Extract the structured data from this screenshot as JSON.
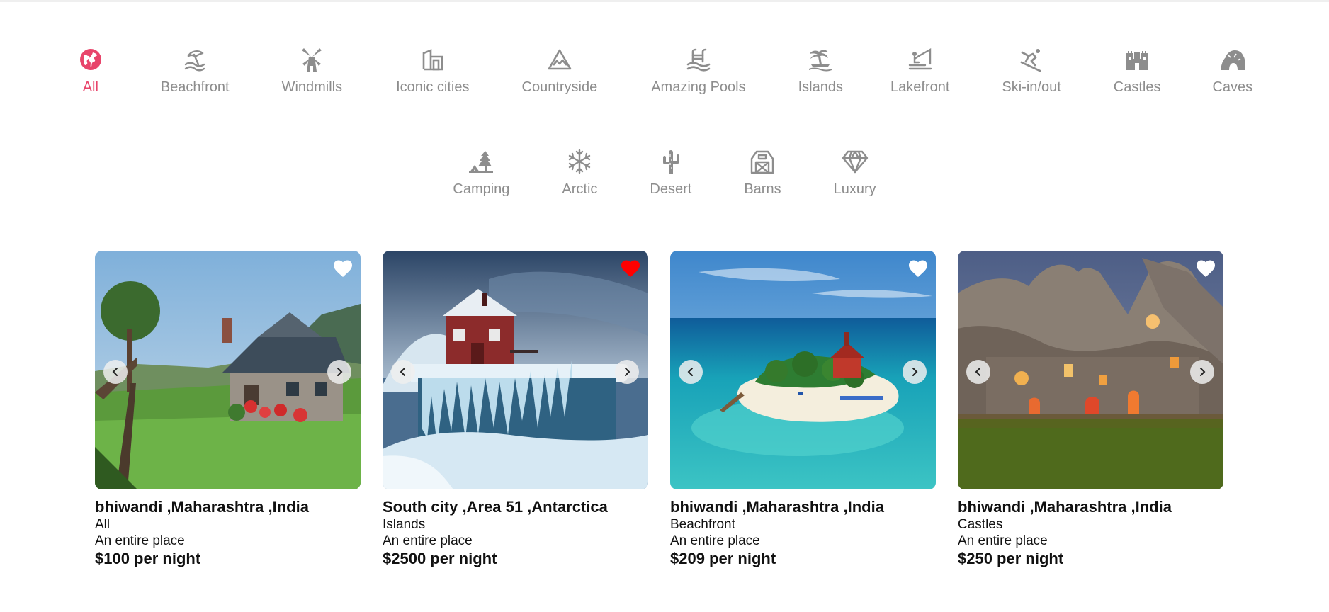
{
  "categories_row1": [
    {
      "label": "All",
      "icon": "globe-icon",
      "active": true
    },
    {
      "label": "Beachfront",
      "icon": "beach-umbrella-icon"
    },
    {
      "label": "Windmills",
      "icon": "windmill-icon"
    },
    {
      "label": "Iconic cities",
      "icon": "city-building-icon"
    },
    {
      "label": "Countryside",
      "icon": "mountain-icon"
    },
    {
      "label": "Amazing Pools",
      "icon": "pool-icon"
    },
    {
      "label": "Islands",
      "icon": "palm-island-icon"
    },
    {
      "label": "Lakefront",
      "icon": "fishing-icon"
    },
    {
      "label": "Ski-in/out",
      "icon": "skier-icon"
    },
    {
      "label": "Castles",
      "icon": "castle-icon"
    },
    {
      "label": "Caves",
      "icon": "cave-icon"
    }
  ],
  "categories_row2": [
    {
      "label": "Camping",
      "icon": "camping-tent-icon"
    },
    {
      "label": "Arctic",
      "icon": "snowflake-icon"
    },
    {
      "label": "Desert",
      "icon": "cactus-icon"
    },
    {
      "label": "Barns",
      "icon": "barn-icon"
    },
    {
      "label": "Luxury",
      "icon": "diamond-icon"
    }
  ],
  "colors": {
    "accent": "#e8456b",
    "category_gray": "#8d8d8d",
    "favorite_red": "#ff0000",
    "text": "#111111"
  },
  "listings": [
    {
      "location": "bhiwandi ,Maharashtra ,India",
      "category": "All",
      "type": "An entire place",
      "price": "$100 per night",
      "favorite": false,
      "image": "cottage-with-garden-photo"
    },
    {
      "location": "South city ,Area 51 ,Antarctica",
      "category": "Islands",
      "type": "An entire place",
      "price": "$2500 per night",
      "favorite": true,
      "image": "red-house-on-iceberg-photo"
    },
    {
      "location": "bhiwandi ,Maharashtra ,India",
      "category": "Beachfront",
      "type": "An entire place",
      "price": "$209 per night",
      "favorite": false,
      "image": "tropical-island-photo"
    },
    {
      "location": "bhiwandi ,Maharashtra ,India",
      "category": "Castles",
      "type": "An entire place",
      "price": "$250 per night",
      "favorite": false,
      "image": "cave-dwellings-at-dusk-photo"
    }
  ]
}
